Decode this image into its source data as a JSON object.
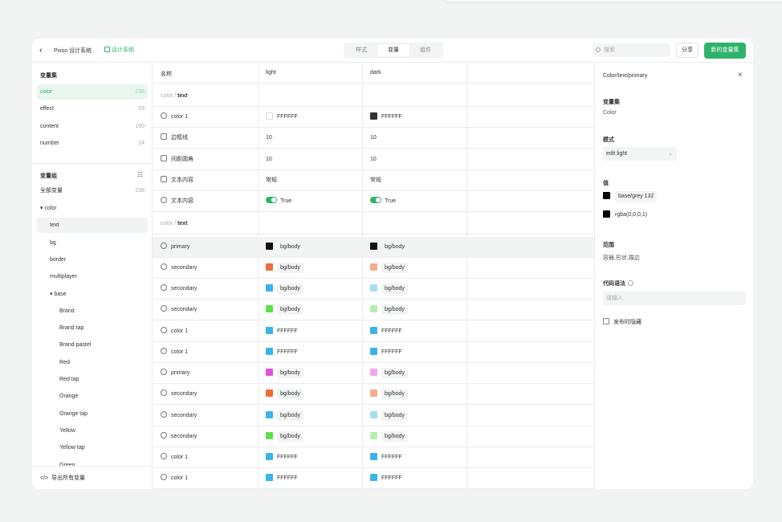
{
  "header": {
    "app_name": "Pixso 设计系统",
    "system_badge": "设计系统",
    "tabs": [
      "样式",
      "变量",
      "组件"
    ],
    "active_tab": "变量",
    "search_placeholder": "搜索",
    "share_label": "分享",
    "primary_label": "新的变量集"
  },
  "sidebar": {
    "collections_title": "变量集",
    "collections": [
      {
        "label": "color",
        "count": "238"
      },
      {
        "label": "effect",
        "count": "59"
      },
      {
        "label": "content",
        "count": "160"
      },
      {
        "label": "number",
        "count": "24"
      }
    ],
    "groups_title": "变量组",
    "all_label": "全部变量",
    "all_count": "238",
    "tree": [
      {
        "label": "▾  color",
        "level": 0
      },
      {
        "label": "text",
        "level": 1
      },
      {
        "label": "bg",
        "level": 1
      },
      {
        "label": "border",
        "level": 1
      },
      {
        "label": "multiplayer",
        "level": 1
      },
      {
        "label": "▾  base",
        "level": 1
      },
      {
        "label": "Brand",
        "level": 2
      },
      {
        "label": "Brand tap",
        "level": 2
      },
      {
        "label": "Brand pastel",
        "level": 2
      },
      {
        "label": "Red",
        "level": 2
      },
      {
        "label": "Red tap",
        "level": 2
      },
      {
        "label": "Orange",
        "level": 2
      },
      {
        "label": "Orange tap",
        "level": 2
      },
      {
        "label": "Yellow",
        "level": 2
      },
      {
        "label": "Yellow tap",
        "level": 2
      },
      {
        "label": "Green",
        "level": 2
      }
    ],
    "export_label": "导出所有变量"
  },
  "table": {
    "columns": [
      "名称",
      "light",
      "dark"
    ],
    "group1_path": "color",
    "group1_leaf": "text",
    "group2_path": "color",
    "group2_leaf": "text",
    "rows1": [
      {
        "name": "color 1",
        "light": "FFFFFF",
        "dark": "FFFFFF",
        "light_color": "#ffffff",
        "dark_color": "#333333",
        "kind": "color"
      },
      {
        "name": "边框线",
        "light": "10",
        "dark": "10",
        "kind": "number"
      },
      {
        "name": "间距圆角",
        "light": "10",
        "dark": "10",
        "kind": "number"
      },
      {
        "name": "文本内容",
        "light": "常规",
        "dark": "常规",
        "kind": "text"
      },
      {
        "name": "文本内容",
        "light": "True",
        "dark": "True",
        "kind": "bool"
      }
    ],
    "rows2": [
      {
        "name": "primary",
        "light": "bg/body",
        "dark": "bg/body",
        "light_color": "#111111",
        "dark_color": "#111111"
      },
      {
        "name": "secondary",
        "light": "bg/body",
        "dark": "bg/body",
        "light_color": "#f26b3a",
        "dark_color": "#f7ab8f"
      },
      {
        "name": "secondary",
        "light": "bg/body",
        "dark": "bg/body",
        "light_color": "#3ab4e8",
        "dark_color": "#a8dcf3"
      },
      {
        "name": "secondary",
        "light": "bg/body",
        "dark": "bg/body",
        "light_color": "#5ee04a",
        "dark_color": "#b4efab"
      },
      {
        "name": "color 1",
        "light": "FFFFFF",
        "dark": "FFFFFF",
        "light_color": "#3ab4e8",
        "dark_color": "#3ab4e8"
      },
      {
        "name": "color 1",
        "light": "FFFFFF",
        "dark": "FFFFFF",
        "light_color": "#3ab4e8",
        "dark_color": "#3ab4e8"
      },
      {
        "name": "primary",
        "light": "bg/body",
        "dark": "bg/body",
        "light_color": "#e84ddc",
        "dark_color": "#f1a8eb"
      },
      {
        "name": "secondary",
        "light": "bg/body",
        "dark": "bg/body",
        "light_color": "#f26b3a",
        "dark_color": "#f7ab8f"
      },
      {
        "name": "secondary",
        "light": "bg/body",
        "dark": "bg/body",
        "light_color": "#3ab4e8",
        "dark_color": "#a8dcf3"
      },
      {
        "name": "secondary",
        "light": "bg/body",
        "dark": "bg/body",
        "light_color": "#5ee04a",
        "dark_color": "#b4efab"
      },
      {
        "name": "color 1",
        "light": "FFFFFF",
        "dark": "FFFFFF",
        "light_color": "#3ab4e8",
        "dark_color": "#3ab4e8"
      },
      {
        "name": "color 1",
        "light": "FFFFFF",
        "dark": "FFFFFF",
        "light_color": "#3ab4e8",
        "dark_color": "#3ab4e8"
      }
    ]
  },
  "panel": {
    "title": "Color/text/primary",
    "collection_label": "变量集",
    "collection_value": "Color",
    "mode_label": "模式",
    "mode_value": "edit light",
    "value_label": "值",
    "value_1": "base/grey 132",
    "value_2": "rgba(0,0,0,1)",
    "scope_label": "范围",
    "scope_value": "容器,形状,描边",
    "code_label": "代码语法",
    "code_placeholder": "请输入",
    "publish_label": "发布时隐藏"
  },
  "colors": {
    "accent": "#2fb36b",
    "selected_bg": "#e9f7ef"
  }
}
